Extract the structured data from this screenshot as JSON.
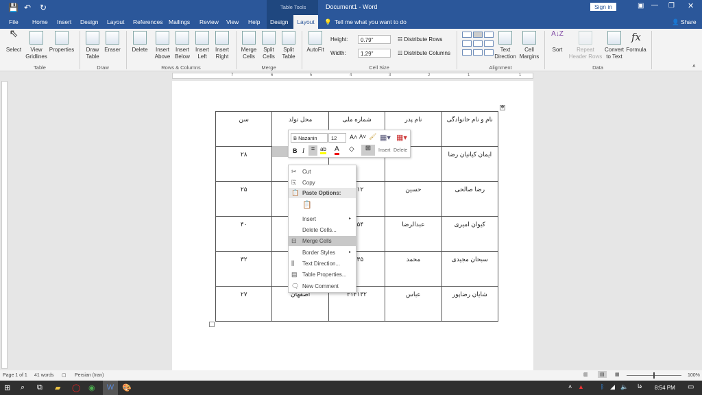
{
  "titlebar": {
    "title": "Document1 - Word",
    "context_group": "Table Tools",
    "sign_in": "Sign in",
    "share": "Share"
  },
  "tabs": [
    "File",
    "Home",
    "Insert",
    "Design",
    "Layout",
    "References",
    "Mailings",
    "Review",
    "View",
    "Help",
    "Design",
    "Layout"
  ],
  "tell_me": "Tell me what you want to do",
  "ribbon": {
    "table": {
      "label": "Table",
      "buttons": [
        "Select",
        "View Gridlines",
        "Properties"
      ]
    },
    "draw": {
      "label": "Draw",
      "buttons": [
        "Draw Table",
        "Eraser"
      ]
    },
    "rows_columns": {
      "label": "Rows & Columns",
      "buttons": [
        "Delete",
        "Insert Above",
        "Insert Below",
        "Insert Left",
        "Insert Right"
      ]
    },
    "merge": {
      "label": "Merge",
      "buttons": [
        "Merge Cells",
        "Split Cells",
        "Split Table"
      ]
    },
    "cell_size": {
      "label": "Cell Size",
      "autofit": "AutoFit",
      "height_label": "Height:",
      "height_value": "0.79\"",
      "width_label": "Width:",
      "width_value": "1.29\"",
      "distribute_rows": "Distribute Rows",
      "distribute_columns": "Distribute Columns"
    },
    "alignment": {
      "label": "Alignment",
      "buttons": [
        "Text Direction",
        "Cell Margins"
      ]
    },
    "data": {
      "label": "Data",
      "buttons": [
        "Sort",
        "Repeat Header Rows",
        "Convert to Text",
        "Formula"
      ]
    }
  },
  "ruler_numbers": [
    "7",
    "6",
    "5",
    "4",
    "3",
    "2",
    "1",
    "1"
  ],
  "table": {
    "headers": [
      "نام و نام خانوادگی",
      "نام پدر",
      "شماره ملی",
      "محل تولد",
      "سن"
    ],
    "rows": [
      [
        "ایمان کیانیان رضا",
        "",
        "",
        "",
        "۲۸"
      ],
      [
        "رضا صالحی",
        "حسین",
        "۱۲۱۲",
        "",
        "۲۵"
      ],
      [
        "کیوان امیری",
        "عبدالرضا",
        "۴۶۵۴",
        "",
        "۴۰"
      ],
      [
        "سبحان مجیدی",
        "محمد",
        "۱۲۳۵",
        "",
        "۳۲"
      ],
      [
        "شایان رضاپور",
        "عباس",
        "۲۱۲۱۳۲",
        "اصفهان",
        "۲۷"
      ]
    ]
  },
  "mini_toolbar": {
    "font": "B Nazanin",
    "size": "12",
    "insert": "Insert",
    "delete": "Delete",
    "bold": "B",
    "italic": "I"
  },
  "context_menu": {
    "items": [
      "Cut",
      "Copy",
      "Paste Options:",
      "Insert",
      "Delete Cells...",
      "Merge Cells",
      "Border Styles",
      "Text Direction...",
      "Table Properties...",
      "New Comment"
    ]
  },
  "status": {
    "page": "Page 1 of 1",
    "words": "41 words",
    "language": "Persian (Iran)",
    "zoom": "100%"
  },
  "taskbar": {
    "time": "8:54 PM",
    "lang": "فا"
  },
  "colors": {
    "word_blue": "#2b579a",
    "ribbon": "#f3f3f3",
    "highlight": "#c8c8c8"
  }
}
